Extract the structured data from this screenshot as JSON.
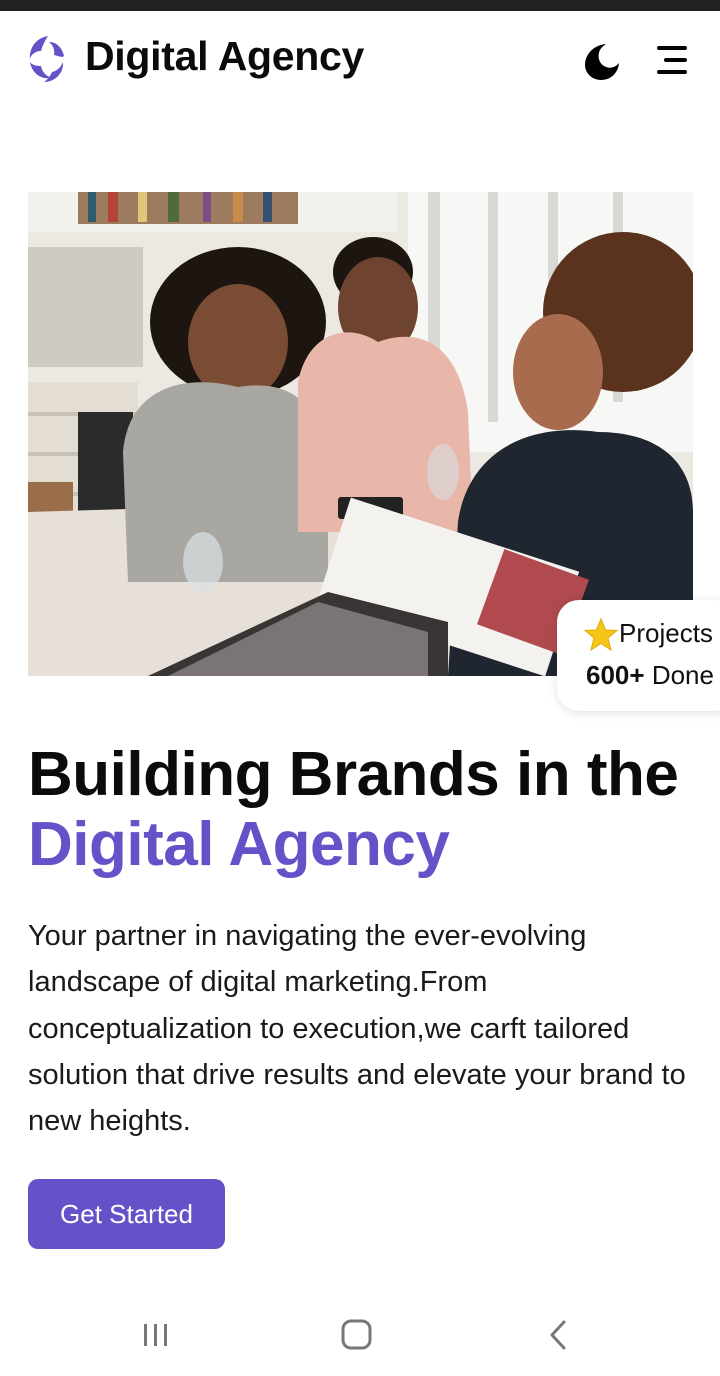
{
  "header": {
    "brand": "Digital Agency",
    "logo_icon": "brand-logo-icon",
    "theme_icon": "moon-icon",
    "menu_icon": "hamburger-menu-icon"
  },
  "hero": {
    "image_alt": "Three people working together at a table with a laptop and documents",
    "badge": {
      "icon": "star-icon",
      "label": "Projects",
      "count": "600+",
      "count_suffix": "Done"
    },
    "headline_line1": "Building Brands in the",
    "headline_accent": "Digital Agency",
    "description": "Your partner in navigating the ever-evolving landscape of digital marketing.From conceptualization to execution,we carft tailored solution that drive results and elevate your brand to new heights.",
    "cta_label": "Get Started"
  },
  "system_nav": {
    "recents_icon": "recents-icon",
    "home_icon": "home-icon",
    "back_icon": "back-chevron-icon"
  },
  "colors": {
    "accent": "#6352c8",
    "text": "#0b0b0b",
    "background": "#ffffff"
  }
}
